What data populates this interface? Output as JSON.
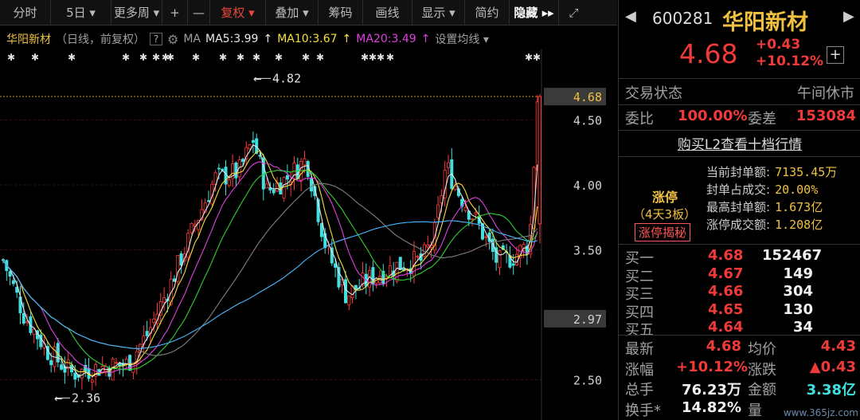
{
  "toolbar": {
    "items": [
      {
        "label": "分时",
        "w": 64
      },
      {
        "label": "5日 ▾",
        "w": 76
      },
      {
        "label": "更多周 ▾",
        "w": 64
      },
      {
        "label": "+",
        "w": 32
      },
      {
        "label": "—",
        "w": 28
      },
      {
        "label": "复权 ▾",
        "w": 70,
        "active": true
      },
      {
        "label": "叠加 ▾",
        "w": 66
      },
      {
        "label": "筹码",
        "w": 56
      },
      {
        "label": "画线",
        "w": 62
      },
      {
        "label": "显示 ▾",
        "w": 66
      },
      {
        "label": "简约",
        "w": 56
      },
      {
        "label": "隐藏 ▸▸",
        "w": 62,
        "bold": true
      }
    ],
    "fullscreen_icon": "expand-icon"
  },
  "legend": {
    "name": "华阳新材",
    "mode": "（日线，前复权）",
    "help": "?",
    "gear_icon": "gear-icon",
    "ma_label": "MA",
    "ma5": "MA5:3.99",
    "ma10": "MA10:3.67",
    "ma20": "MA20:3.49",
    "setting": "设置均线 ▾",
    "ma5_color": "#e8e8e8",
    "ma10_color": "#f5e03a",
    "ma20_color": "#e040e0"
  },
  "chart_data": {
    "type": "candlestick",
    "y_axis_labels": [
      "4.68",
      "4.50",
      "4.00",
      "3.50",
      "2.97",
      "2.50"
    ],
    "high_marker": "4.82",
    "low_marker": "2.36",
    "last_price": "4.68",
    "current_price_line": 4.68,
    "prev_close_line": 2.97,
    "colors": {
      "up": "#ff3b3b",
      "down": "#40e0e0",
      "ma5": "#e8e8e8",
      "ma10": "#f5e03a",
      "ma20": "#e040e0",
      "ma60": "#30d030",
      "ma120": "#808080",
      "ma250": "#4ab8ff"
    }
  },
  "panel": {
    "code": "600281",
    "name": "华阳新材",
    "price": "4.68",
    "change": "+0.43",
    "change_pct": "+10.12%",
    "status_label": "交易状态",
    "status_value": "午间休市",
    "weibi_label": "委比",
    "weibi_value": "100.00%",
    "weicha_label": "委差",
    "weicha_value": "153084",
    "l2_link": "购买L2查看十档行情",
    "zt_title": "涨停",
    "zt_board": "（4天3板）",
    "zt_button": "涨停揭秘",
    "zt_rows": [
      {
        "label": "当前封单额:",
        "value": "7135.45万"
      },
      {
        "label": "封单占成交:",
        "value": "20.00%"
      },
      {
        "label": "最高封单额:",
        "value": "1.673亿"
      },
      {
        "label": "涨停成交额:",
        "value": "1.208亿"
      }
    ],
    "bids": [
      {
        "label": "买一",
        "price": "4.68",
        "vol": "152467"
      },
      {
        "label": "买二",
        "price": "4.67",
        "vol": "149"
      },
      {
        "label": "买三",
        "price": "4.66",
        "vol": "304"
      },
      {
        "label": "买四",
        "price": "4.65",
        "vol": "130"
      },
      {
        "label": "买五",
        "price": "4.64",
        "vol": "34"
      }
    ],
    "stats": [
      {
        "l1": "最新",
        "v1": "4.68",
        "c1": "red",
        "l2": "均价",
        "v2": "4.43",
        "c2": "red"
      },
      {
        "l1": "涨幅",
        "v1": "+10.12%",
        "c1": "red",
        "l2": "涨跌",
        "v2": "▲0.43",
        "c2": "red"
      },
      {
        "l1": "总手",
        "v1": "76.23万",
        "c1": "white",
        "l2": "金额",
        "v2": "3.38亿",
        "c2": "cyan"
      },
      {
        "l1": "换手*",
        "v1": "14.82%",
        "c1": "white",
        "l2": "量",
        "v2": "",
        "c2": "white"
      }
    ],
    "watermark": "www.365jz.com"
  }
}
